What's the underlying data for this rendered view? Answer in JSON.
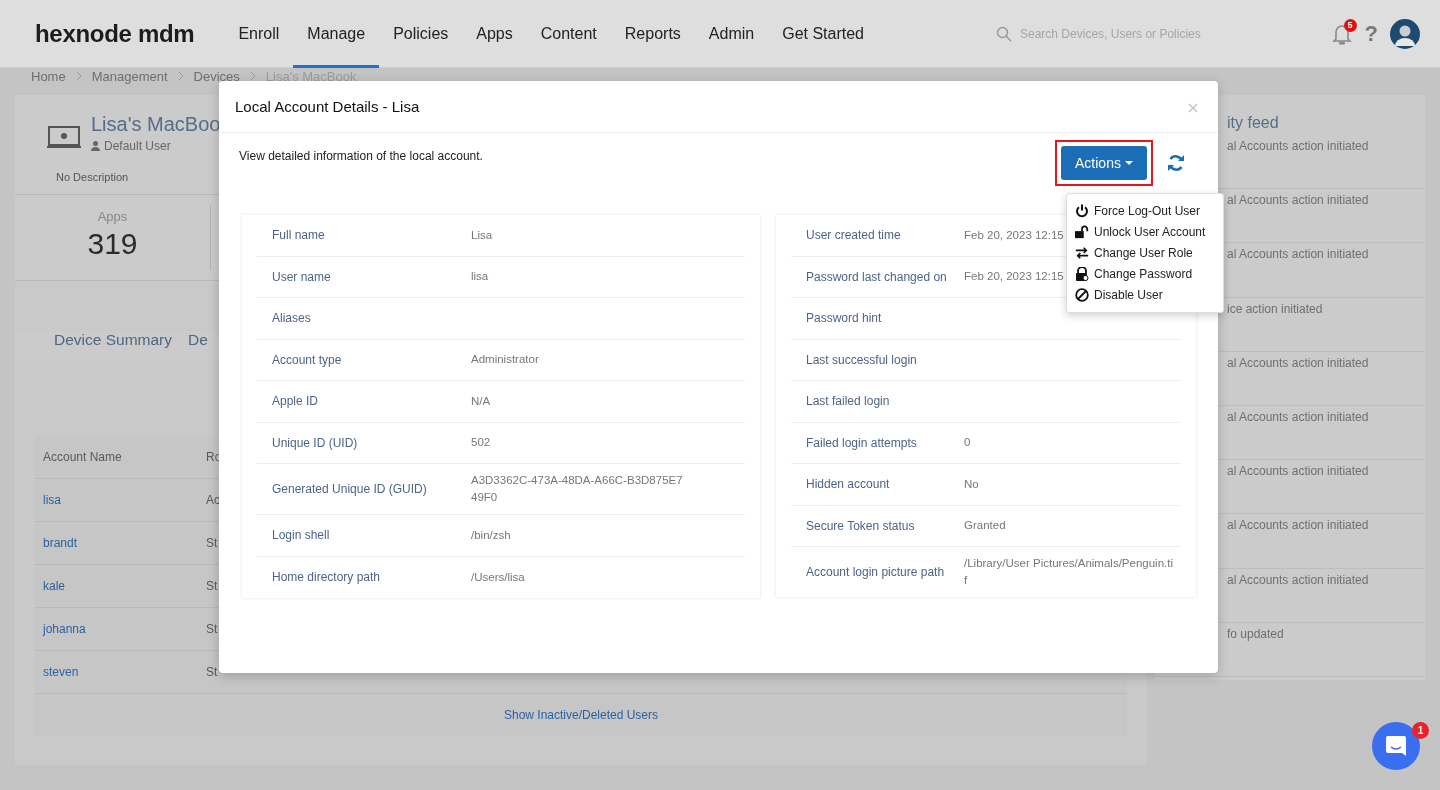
{
  "header": {
    "logo": "hexnode mdm",
    "nav": [
      {
        "label": "Enroll",
        "selected": false
      },
      {
        "label": "Manage",
        "selected": true
      },
      {
        "label": "Policies",
        "selected": false
      },
      {
        "label": "Apps",
        "selected": false
      },
      {
        "label": "Content",
        "selected": false
      },
      {
        "label": "Reports",
        "selected": false
      },
      {
        "label": "Admin",
        "selected": false
      },
      {
        "label": "Get Started",
        "selected": false
      }
    ],
    "search": {
      "placeholder": "Search Devices, Users or Policies"
    },
    "notification_count": "5",
    "help": "?"
  },
  "breadcrumb": [
    "Home",
    "Management",
    "Devices",
    "Lisa's MacBook"
  ],
  "device": {
    "name": "Lisa's MacBoo",
    "user": "Default User",
    "description": "No Description"
  },
  "stats": [
    {
      "label": "Apps",
      "value": "319"
    }
  ],
  "device_tabs": [
    "Device Summary",
    "De"
  ],
  "accounts_table": {
    "columns": [
      "Account Name",
      "Ro"
    ],
    "rows": [
      {
        "name": "lisa",
        "column_2": "Ac"
      },
      {
        "name": "brandt",
        "column_2": "St"
      },
      {
        "name": "kale",
        "column_2": "St"
      },
      {
        "name": "johanna",
        "column_2": "St"
      },
      {
        "name": "steven",
        "column_2": "St"
      }
    ],
    "footer_link": "Show Inactive/Deleted Users"
  },
  "activity_feed": {
    "title": "ity feed",
    "items": [
      "al Accounts action initiated",
      "al Accounts action initiated",
      "al Accounts action initiated",
      "ice action initiated",
      "al Accounts action initiated",
      "al Accounts action initiated",
      "al Accounts action initiated",
      "al Accounts action initiated",
      "al Accounts action initiated",
      "fo updated"
    ]
  },
  "modal": {
    "title": "Local Account Details - Lisa",
    "description": "View detailed information of the local account.",
    "actions_button": "Actions",
    "left_details": [
      {
        "label": "Full name",
        "value": "Lisa"
      },
      {
        "label": "User name",
        "value": "lisa"
      },
      {
        "label": "Aliases"
      },
      {
        "label": "Account type",
        "value": "Administrator"
      },
      {
        "label": "Apple ID",
        "value": "N/A"
      },
      {
        "label": "Unique ID (UID)",
        "value": "502"
      },
      {
        "label": "Generated Unique ID (GUID)",
        "value": "A3D3362C-473A-48DA-A66C-B3D875E749F0"
      },
      {
        "label": "Login shell",
        "value": "/bin/zsh"
      },
      {
        "label": "Home directory path",
        "value": "/Users/lisa"
      }
    ],
    "right_details": [
      {
        "label": "User created time",
        "value": "Feb 20, 2023 12:15"
      },
      {
        "label": "Password last changed on",
        "value": "Feb 20, 2023 12:15"
      },
      {
        "label": "Password hint"
      },
      {
        "label": "Last successful login"
      },
      {
        "label": "Last failed login"
      },
      {
        "label": "Failed login attempts",
        "value": "0"
      },
      {
        "label": "Hidden account",
        "value": "No"
      },
      {
        "label": "Secure Token status",
        "value": "Granted"
      },
      {
        "label": "Account login picture path",
        "value": "/Library/User Pictures/Animals/Penguin.tif"
      }
    ],
    "actions_menu": [
      {
        "label": "Force Log-Out User",
        "kind": "power"
      },
      {
        "label": "Unlock User Account",
        "kind": "unlock"
      },
      {
        "label": "Change User Role",
        "kind": "swap"
      },
      {
        "label": "Change Password",
        "kind": "password"
      },
      {
        "label": "Disable User",
        "kind": "ban"
      }
    ]
  },
  "chat": {
    "badge": "1"
  }
}
